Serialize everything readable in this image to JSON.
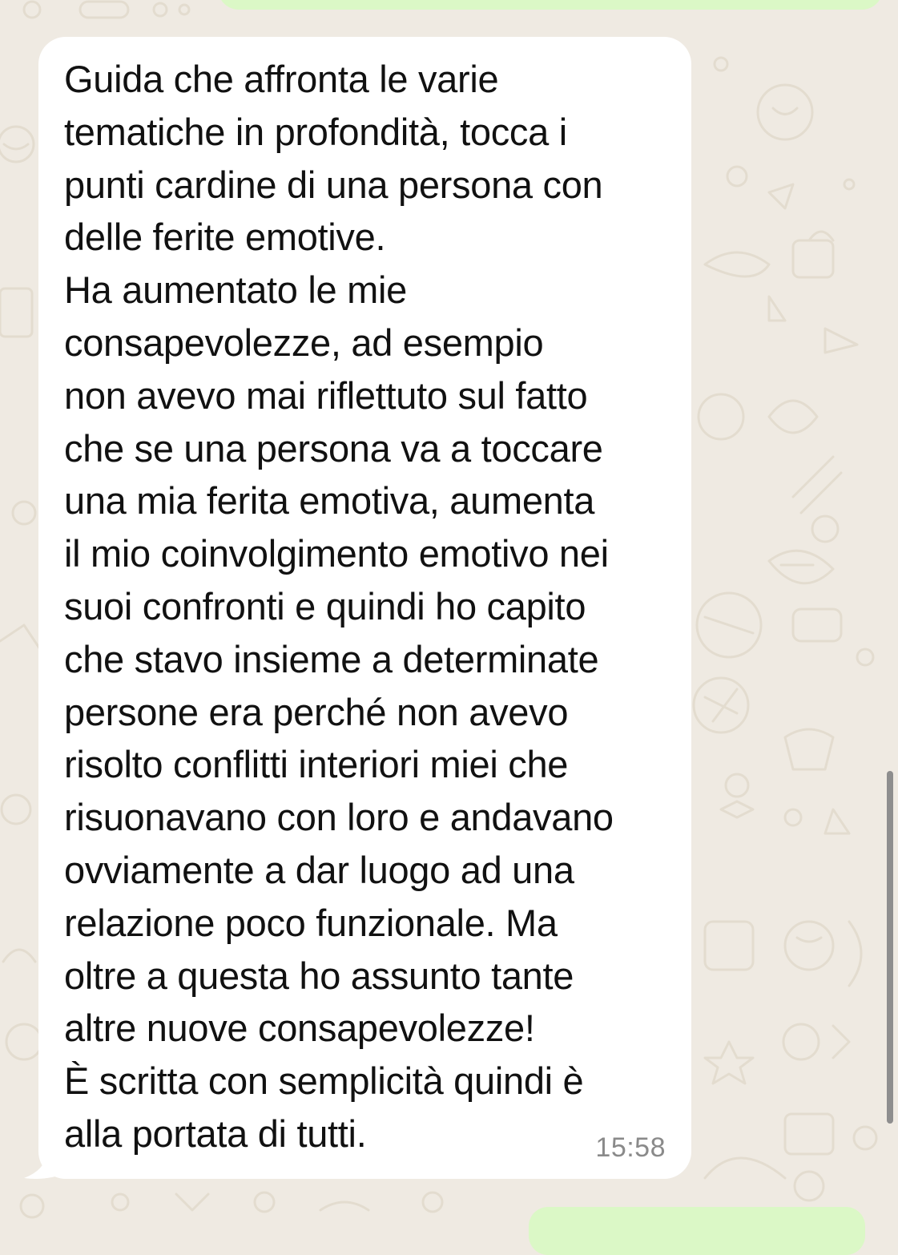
{
  "chat": {
    "incoming_message": {
      "lines": [
        "Guida che affronta le varie",
        "tematiche in profondità, tocca i",
        "punti cardine di una persona con",
        "delle ferite emotive.",
        "Ha aumentato le mie",
        "consapevolezze, ad esempio",
        "non avevo mai riflettuto sul fatto",
        "che se una persona va a toccare",
        "una mia ferita emotiva, aumenta",
        "il mio coinvolgimento emotivo nei",
        "suoi confronti e quindi ho capito",
        "che stavo insieme a determinate",
        "persone era perché non avevo",
        "risolto conflitti interiori miei che",
        "risuonavano con loro e andavano",
        "ovviamente a dar luogo ad una",
        "relazione poco funzionale. Ma",
        "oltre a questa ho assunto tante",
        "altre nuove consapevolezze!",
        "È scritta con semplicità quindi è",
        "alla portata di tutti."
      ],
      "time": "15:58"
    }
  },
  "colors": {
    "wallpaper": "#efeae2",
    "doodle": "#e3dccf",
    "incoming_bubble": "#ffffff",
    "outgoing_bubble": "#dbf8c6",
    "text": "#111111",
    "timestamp": "#8a8a8a",
    "scrollbar": "#8e8e8e"
  }
}
